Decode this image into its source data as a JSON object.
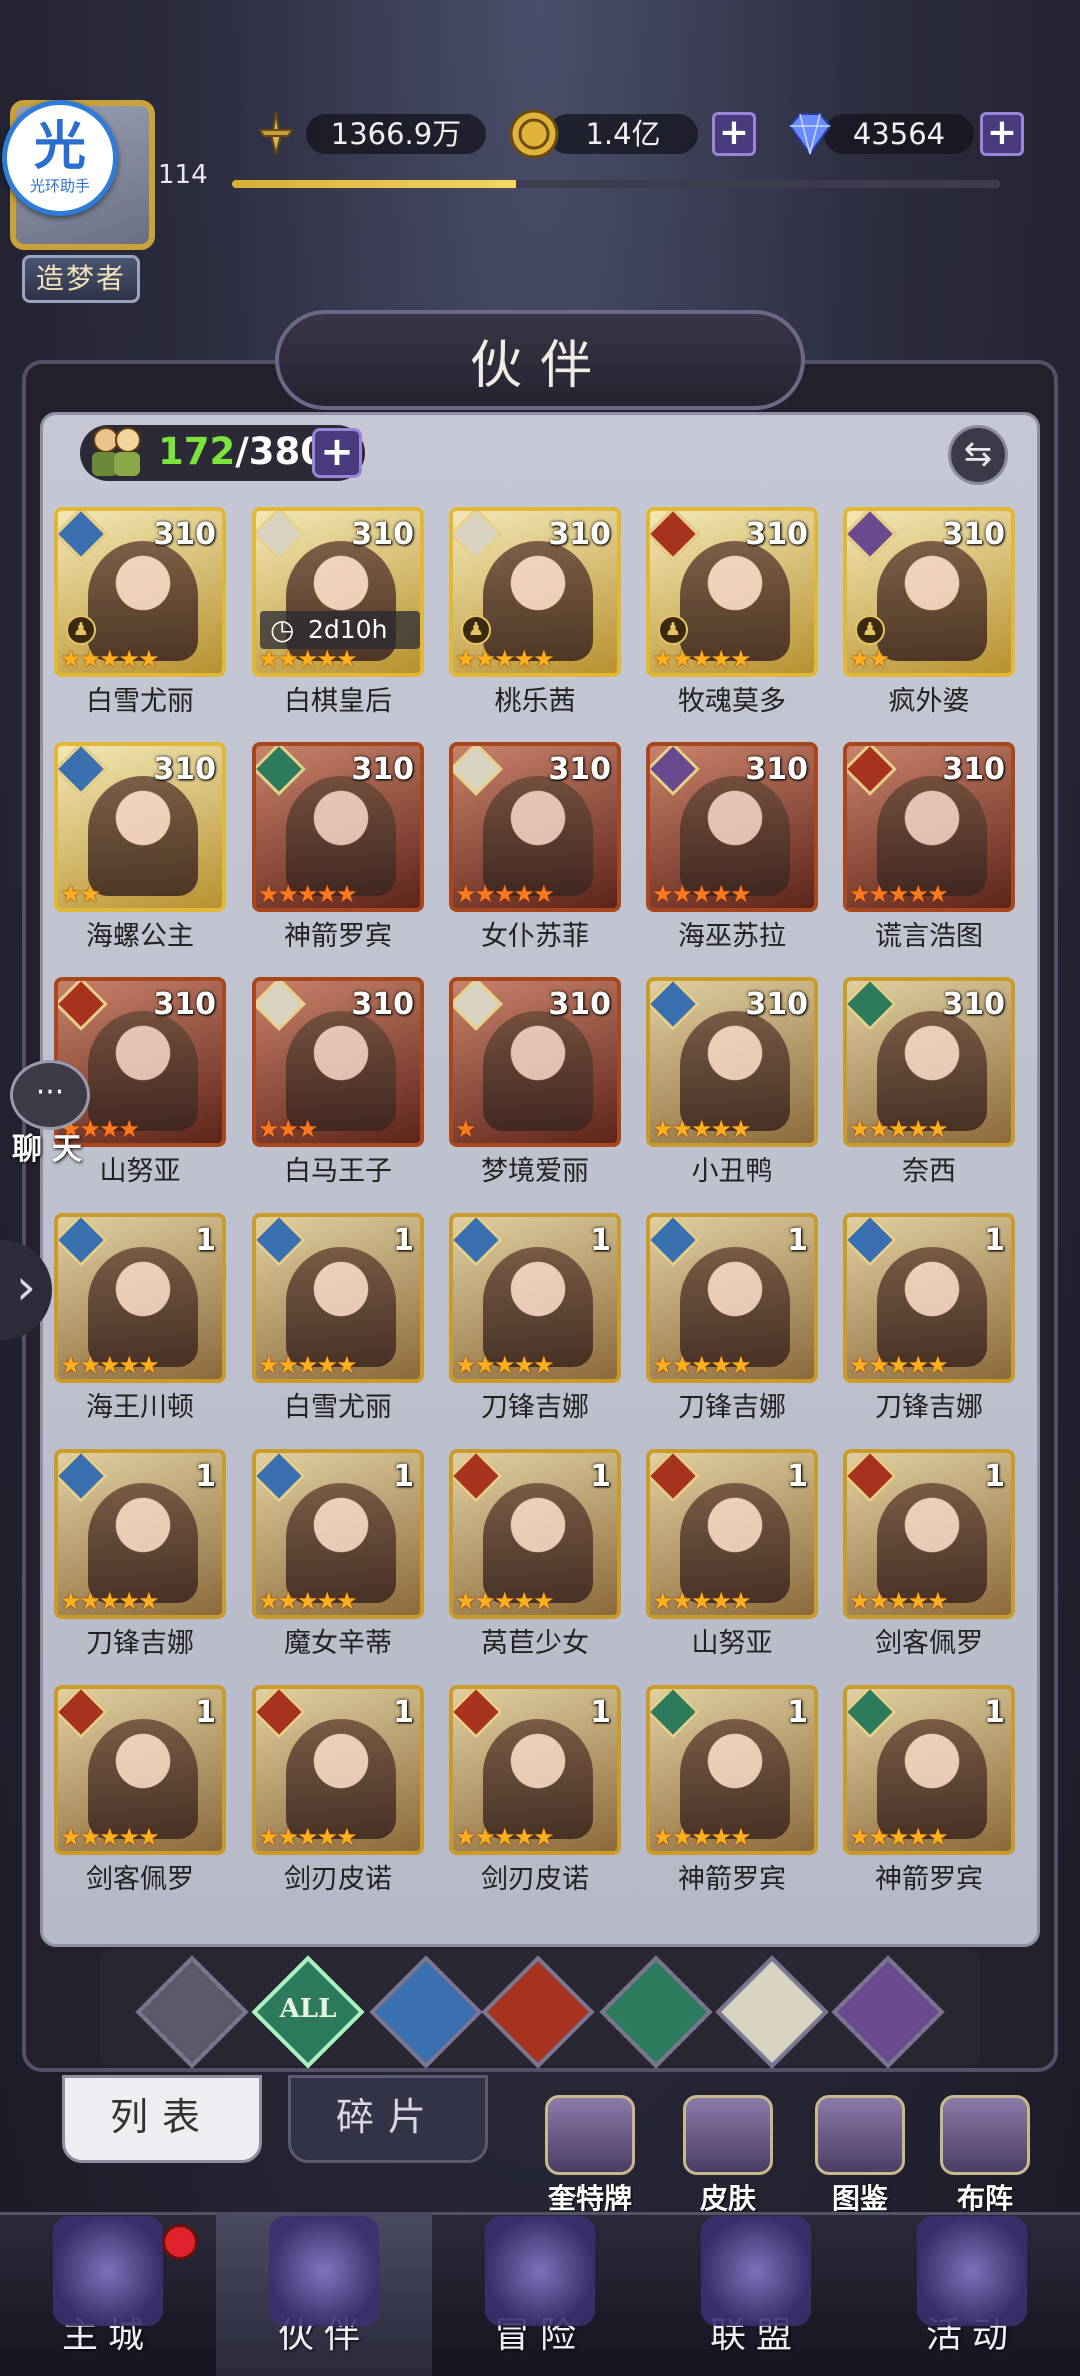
{
  "header": {
    "helper_logo_char": "光",
    "helper_logo_text": "光环助手",
    "level": "114",
    "title_badge": "造梦者",
    "power": "1366.9万",
    "gold": "1.4亿",
    "gems": "43564",
    "plus": "+",
    "xp_fraction": 0.37
  },
  "panel": {
    "title": "伙伴",
    "count_current": "172",
    "count_max": "/380",
    "plus": "+",
    "swap_icon": "⇆"
  },
  "heroes": [
    {
      "name": "白雪尤丽",
      "level": "310",
      "stars": "★★★★★",
      "element": "water",
      "frame": "gold",
      "pawn": true
    },
    {
      "name": "白棋皇后",
      "level": "310",
      "stars": "★★★★★",
      "element": "light",
      "frame": "gold",
      "timer": "2d10h"
    },
    {
      "name": "桃乐茜",
      "level": "310",
      "stars": "★★★★★",
      "element": "light",
      "frame": "gold",
      "pawn": true
    },
    {
      "name": "牧魂莫多",
      "level": "310",
      "stars": "★★★★★",
      "element": "fire",
      "frame": "gold",
      "pawn": true
    },
    {
      "name": "疯外婆",
      "level": "310",
      "stars": "★★",
      "element": "dark",
      "frame": "gold",
      "pawn": true
    },
    {
      "name": "海螺公主",
      "level": "310",
      "stars": "★★",
      "element": "water",
      "frame": "gold"
    },
    {
      "name": "神箭罗宾",
      "level": "310",
      "stars": "★★★★★",
      "element": "wind",
      "frame": "red"
    },
    {
      "name": "女仆苏菲",
      "level": "310",
      "stars": "★★★★★",
      "element": "light",
      "frame": "red"
    },
    {
      "name": "海巫苏拉",
      "level": "310",
      "stars": "★★★★★",
      "element": "dark",
      "frame": "red"
    },
    {
      "name": "谎言浩图",
      "level": "310",
      "stars": "★★★★★",
      "element": "fire",
      "frame": "red"
    },
    {
      "name": "山努亚",
      "level": "310",
      "stars": "★★★★",
      "element": "fire",
      "frame": "red"
    },
    {
      "name": "白马王子",
      "level": "310",
      "stars": "★★★",
      "element": "light",
      "frame": "red"
    },
    {
      "name": "梦境爱丽",
      "level": "310",
      "stars": "★",
      "element": "light",
      "frame": "red"
    },
    {
      "name": "小丑鸭",
      "level": "310",
      "stars": "★★★★★",
      "element": "water",
      "frame": "normal"
    },
    {
      "name": "奈西",
      "level": "310",
      "stars": "★★★★★",
      "element": "wind",
      "frame": "normal"
    },
    {
      "name": "海王川顿",
      "level": "1",
      "stars": "★★★★★",
      "element": "water",
      "frame": "normal"
    },
    {
      "name": "白雪尤丽",
      "level": "1",
      "stars": "★★★★★",
      "element": "water",
      "frame": "normal"
    },
    {
      "name": "刀锋吉娜",
      "level": "1",
      "stars": "★★★★★",
      "element": "water",
      "frame": "normal"
    },
    {
      "name": "刀锋吉娜",
      "level": "1",
      "stars": "★★★★★",
      "element": "water",
      "frame": "normal"
    },
    {
      "name": "刀锋吉娜",
      "level": "1",
      "stars": "★★★★★",
      "element": "water",
      "frame": "normal"
    },
    {
      "name": "刀锋吉娜",
      "level": "1",
      "stars": "★★★★★",
      "element": "water",
      "frame": "normal"
    },
    {
      "name": "魔女辛蒂",
      "level": "1",
      "stars": "★★★★★",
      "element": "water",
      "frame": "normal"
    },
    {
      "name": "莴苣少女",
      "level": "1",
      "stars": "★★★★★",
      "element": "fire",
      "frame": "normal"
    },
    {
      "name": "山努亚",
      "level": "1",
      "stars": "★★★★★",
      "element": "fire",
      "frame": "normal"
    },
    {
      "name": "剑客佩罗",
      "level": "1",
      "stars": "★★★★★",
      "element": "fire",
      "frame": "normal"
    },
    {
      "name": "剑客佩罗",
      "level": "1",
      "stars": "★★★★★",
      "element": "fire",
      "frame": "normal"
    },
    {
      "name": "剑刃皮诺",
      "level": "1",
      "stars": "★★★★★",
      "element": "fire",
      "frame": "normal"
    },
    {
      "name": "剑刃皮诺",
      "level": "1",
      "stars": "★★★★★",
      "element": "fire",
      "frame": "normal"
    },
    {
      "name": "神箭罗宾",
      "level": "1",
      "stars": "★★★★★",
      "element": "wind",
      "frame": "normal"
    },
    {
      "name": "神箭罗宾",
      "level": "1",
      "stars": "★★★★★",
      "element": "wind",
      "frame": "normal"
    }
  ],
  "filters": [
    {
      "name": "all-dark",
      "label": ""
    },
    {
      "name": "all",
      "label": "ALL"
    },
    {
      "name": "water",
      "label": ""
    },
    {
      "name": "fire",
      "label": ""
    },
    {
      "name": "wind",
      "label": ""
    },
    {
      "name": "light",
      "label": ""
    },
    {
      "name": "dark",
      "label": ""
    }
  ],
  "subtabs": {
    "list": "列表",
    "fragments": "碎片"
  },
  "quick_actions": [
    "奎特牌",
    "皮肤",
    "图鉴",
    "布阵"
  ],
  "chat": {
    "label": "聊天",
    "icon": "···"
  },
  "side_arrow": "›",
  "nav": [
    "主城",
    "伙伴",
    "冒险",
    "联盟",
    "活动"
  ]
}
